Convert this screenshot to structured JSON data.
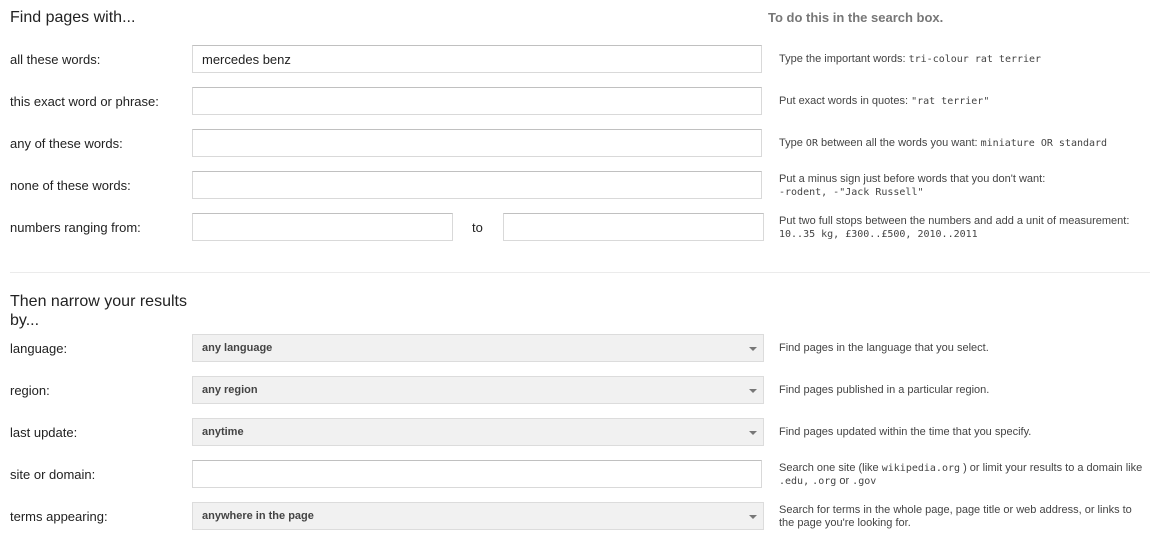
{
  "find": {
    "title": "Find pages with...",
    "side_heading": "To do this in the search box.",
    "rows": {
      "all": {
        "label": "all these words:",
        "value": "mercedes benz",
        "hint_text": "Type the important words:",
        "hint_code": "tri-colour rat terrier"
      },
      "exact": {
        "label": "this exact word or phrase:",
        "value": "",
        "hint_text": "Put exact words in quotes:",
        "hint_code": "\"rat terrier\""
      },
      "any": {
        "label": "any of these words:",
        "value": "",
        "hint_pre": "Type",
        "hint_or": "OR",
        "hint_text": "between all the words you want:",
        "hint_code": "miniature OR standard"
      },
      "none": {
        "label": "none of these words:",
        "value": "",
        "hint_text": "Put a minus sign just before words that you don't want:",
        "hint_code": "-rodent, -\"Jack Russell\""
      },
      "range": {
        "label": "numbers ranging from:",
        "from_value": "",
        "to_label": "to",
        "to_value": "",
        "hint_text": "Put two full stops between the numbers and add a unit of measurement:",
        "hint_code": "10..35 kg, £300..£500, 2010..2011"
      }
    }
  },
  "narrow": {
    "title": "Then narrow your results by...",
    "rows": {
      "language": {
        "label": "language:",
        "selected": "any language",
        "hint": "Find pages in the language that you select."
      },
      "region": {
        "label": "region:",
        "selected": "any region",
        "hint": "Find pages published in a particular region."
      },
      "update": {
        "label": "last update:",
        "selected": "anytime",
        "hint": "Find pages updated within the time that you specify."
      },
      "site": {
        "label": "site or domain:",
        "value": "",
        "hint_pre": "Search one site (like",
        "hint_code1": "wikipedia.org",
        "hint_mid": ") or limit your results to a domain like",
        "hint_code2": ".edu,",
        "hint_code3": ".org",
        "hint_or": "or",
        "hint_code4": ".gov"
      },
      "terms": {
        "label": "terms appearing:",
        "selected": "anywhere in the page",
        "hint": "Search for terms in the whole page, page title or web address, or links to the page you're looking for."
      }
    }
  }
}
